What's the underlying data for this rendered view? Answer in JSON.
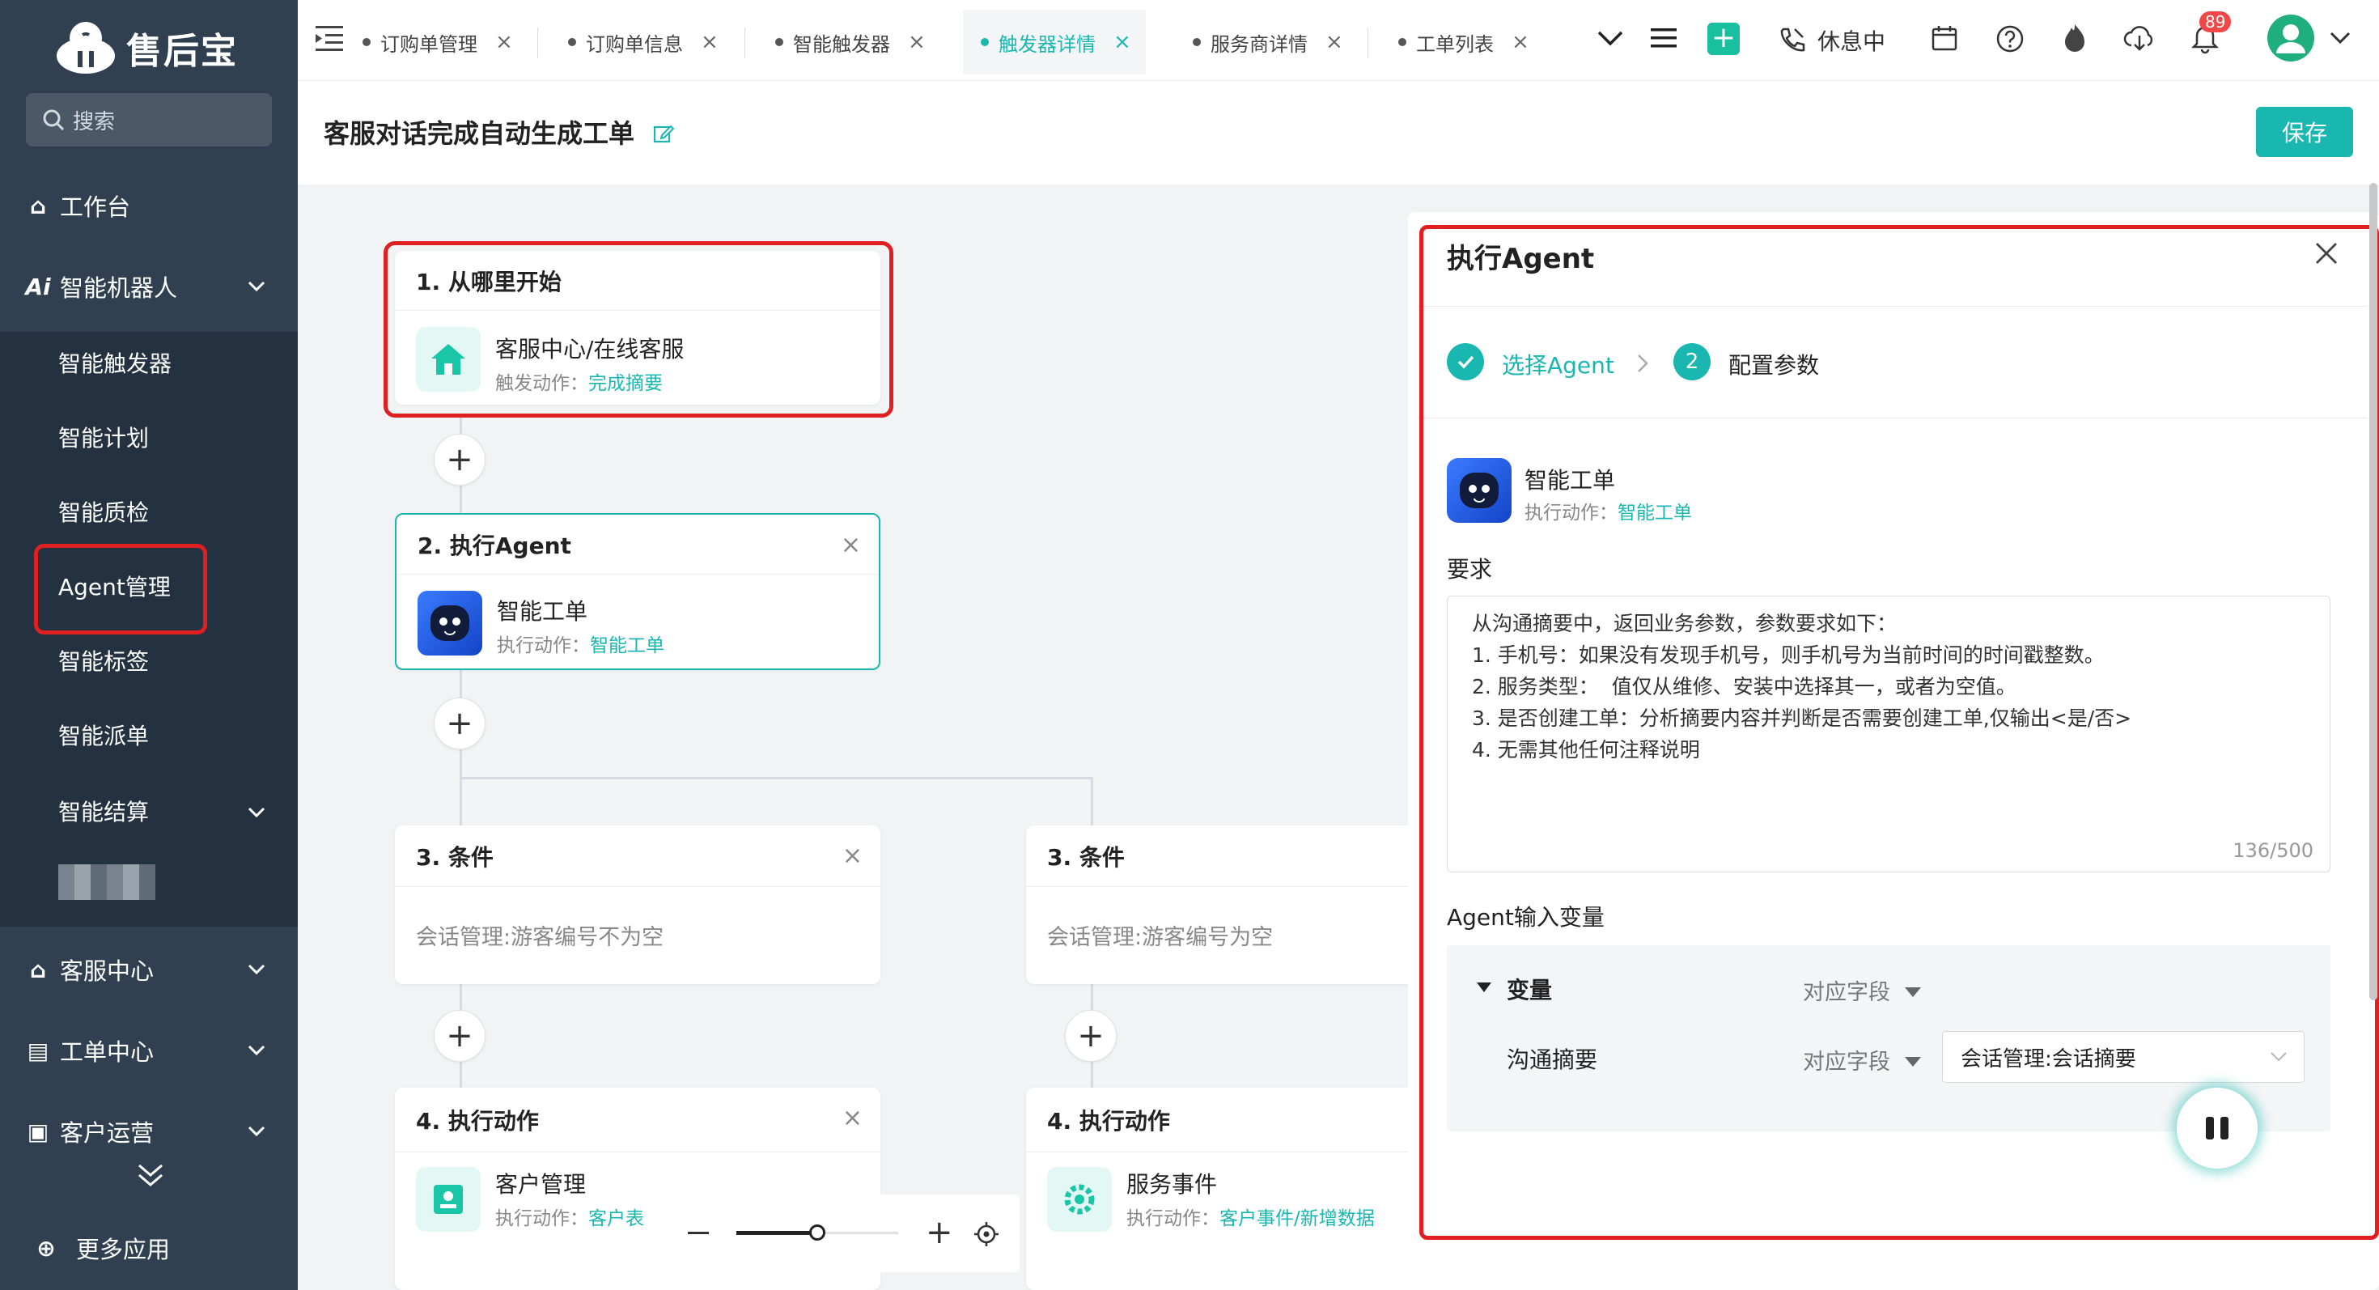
{
  "app": {
    "name": "售后宝"
  },
  "sidebar": {
    "search_label": "搜索",
    "items": [
      {
        "label": "工作台"
      },
      {
        "label": "智能机器人"
      },
      {
        "label": "客服中心"
      },
      {
        "label": "工单中心"
      },
      {
        "label": "客户运营"
      },
      {
        "label": "更多应用"
      }
    ],
    "subitems": [
      {
        "label": "智能触发器"
      },
      {
        "label": "智能计划"
      },
      {
        "label": "智能质检"
      },
      {
        "label": "Agent管理"
      },
      {
        "label": "智能标签"
      },
      {
        "label": "智能派单"
      },
      {
        "label": "智能结算"
      }
    ]
  },
  "tabs": [
    {
      "label": "订购单管理"
    },
    {
      "label": "订购单信息"
    },
    {
      "label": "智能触发器"
    },
    {
      "label": "触发器详情",
      "active": true
    },
    {
      "label": "服务商详情"
    },
    {
      "label": "工单列表"
    }
  ],
  "toolbar": {
    "status_label": "休息中",
    "notification_count": "89"
  },
  "page": {
    "title": "客服对话完成自动生成工单",
    "save_label": "保存"
  },
  "flow": {
    "card1": {
      "title": "1.  从哪里开始",
      "name": "客服中心/在线客服",
      "sub_label": "触发动作：",
      "sub_link": "完成摘要"
    },
    "card2": {
      "title": "2.  执行Agent",
      "name": "智能工单",
      "sub_label": "执行动作：",
      "sub_link": "智能工单"
    },
    "card3a": {
      "title": "3.  条件",
      "text": "会话管理:游客编号不为空"
    },
    "card3b": {
      "title": "3.  条件",
      "text": "会话管理:游客编号为空"
    },
    "card4a": {
      "title": "4.  执行动作",
      "name": "客户管理",
      "sub_label": "执行动作：",
      "sub_link": "客户表"
    },
    "card4b": {
      "title": "4.  执行动作",
      "name": "服务事件",
      "sub_label": "执行动作：",
      "sub_link": "客户事件/新增数据"
    }
  },
  "panel": {
    "title": "执行Agent",
    "step1": "选择Agent",
    "step2_num": "2",
    "step2": "配置参数",
    "agent_name": "智能工单",
    "agent_sub_label": "执行动作：",
    "agent_sub_link": "智能工单",
    "requirement_label": "要求",
    "requirement_lines": [
      "从沟通摘要中，返回业务参数，参数要求如下：",
      "1. 手机号：如果没有发现手机号，则手机号为当前时间的时间戳整数。",
      "2. 服务类型：  值仅从维修、安装中选择其一，或者为空值。",
      "3. 是否创建工单：分析摘要内容并判断是否需要创建工单,仅输出<是/否>",
      "4. 无需其他任何注释说明"
    ],
    "counter": "136/500",
    "vars_label": "Agent输入变量",
    "var_header": "变量",
    "field_header": "对应字段",
    "var_name": "沟通摘要",
    "var_field_label": "对应字段",
    "var_value": "会话管理:会话摘要"
  },
  "colors": {
    "accent": "#19b7b0",
    "sidebar": "#314050",
    "highlight": "#e02020"
  }
}
